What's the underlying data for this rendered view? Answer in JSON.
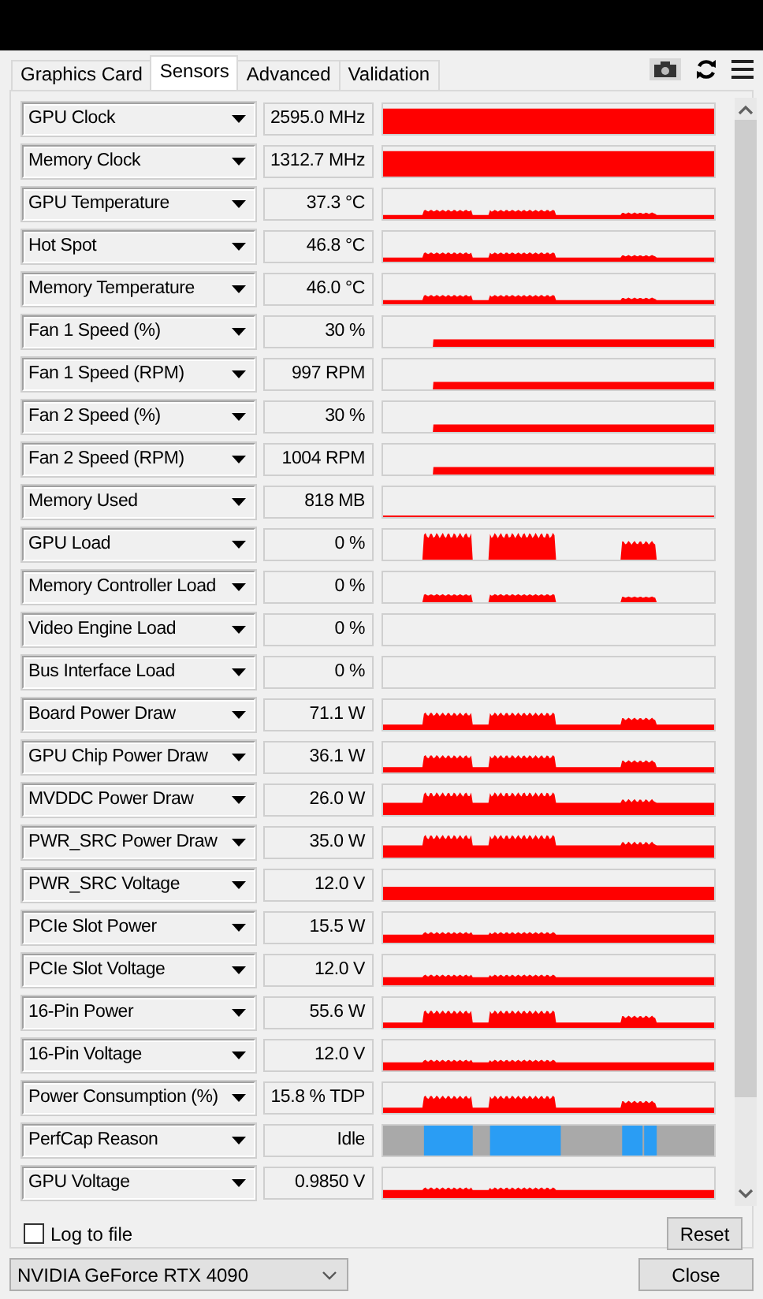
{
  "tabs": [
    {
      "label": "Graphics Card",
      "selected": false
    },
    {
      "label": "Sensors",
      "selected": true
    },
    {
      "label": "Advanced",
      "selected": false
    },
    {
      "label": "Validation",
      "selected": false
    }
  ],
  "sensors": [
    {
      "name": "GPU Clock",
      "value": "2595.0 MHz",
      "kind": "full"
    },
    {
      "name": "Memory Clock",
      "value": "1312.7 MHz",
      "kind": "full"
    },
    {
      "name": "GPU Temperature",
      "value": "37.3 °C",
      "kind": "temp"
    },
    {
      "name": "Hot Spot",
      "value": "46.8 °C",
      "kind": "temp"
    },
    {
      "name": "Memory Temperature",
      "value": "46.0 °C",
      "kind": "temp"
    },
    {
      "name": "Fan 1 Speed (%)",
      "value": "30 %",
      "kind": "fan"
    },
    {
      "name": "Fan 1 Speed (RPM)",
      "value": "997 RPM",
      "kind": "fan"
    },
    {
      "name": "Fan 2 Speed (%)",
      "value": "30 %",
      "kind": "fan"
    },
    {
      "name": "Fan 2 Speed (RPM)",
      "value": "1004 RPM",
      "kind": "fan"
    },
    {
      "name": "Memory Used",
      "value": "818 MB",
      "kind": "trace"
    },
    {
      "name": "GPU Load",
      "value": "0 %",
      "kind": "load"
    },
    {
      "name": "Memory Controller Load",
      "value": "0 %",
      "kind": "lowload"
    },
    {
      "name": "Video Engine Load",
      "value": "0 %",
      "kind": "empty"
    },
    {
      "name": "Bus Interface Load",
      "value": "0 %",
      "kind": "empty"
    },
    {
      "name": "Board Power Draw",
      "value": "71.1 W",
      "kind": "power"
    },
    {
      "name": "GPU Chip Power Draw",
      "value": "36.1 W",
      "kind": "power"
    },
    {
      "name": "MVDDC Power Draw",
      "value": "26.0 W",
      "kind": "rail"
    },
    {
      "name": "PWR_SRC Power Draw",
      "value": "35.0 W",
      "kind": "rail"
    },
    {
      "name": "PWR_SRC Voltage",
      "value": "12.0 V",
      "kind": "level"
    },
    {
      "name": "PCIe Slot Power",
      "value": "15.5 W",
      "kind": "slot"
    },
    {
      "name": "PCIe Slot Voltage",
      "value": "12.0 V",
      "kind": "slot"
    },
    {
      "name": "16-Pin Power",
      "value": "55.6 W",
      "kind": "power"
    },
    {
      "name": "16-Pin Voltage",
      "value": "12.0 V",
      "kind": "slot"
    },
    {
      "name": "Power Consumption (%)",
      "value": "15.8 % TDP",
      "kind": "power"
    },
    {
      "name": "PerfCap Reason",
      "value": "Idle",
      "kind": "perfcap"
    },
    {
      "name": "GPU Voltage",
      "value": "0.9850 V",
      "kind": "slot"
    }
  ],
  "log_to_file": {
    "label": "Log to file",
    "checked": false
  },
  "reset_button": "Reset",
  "device_select": {
    "value": "NVIDIA GeForce RTX 4090"
  },
  "close_button": "Close"
}
